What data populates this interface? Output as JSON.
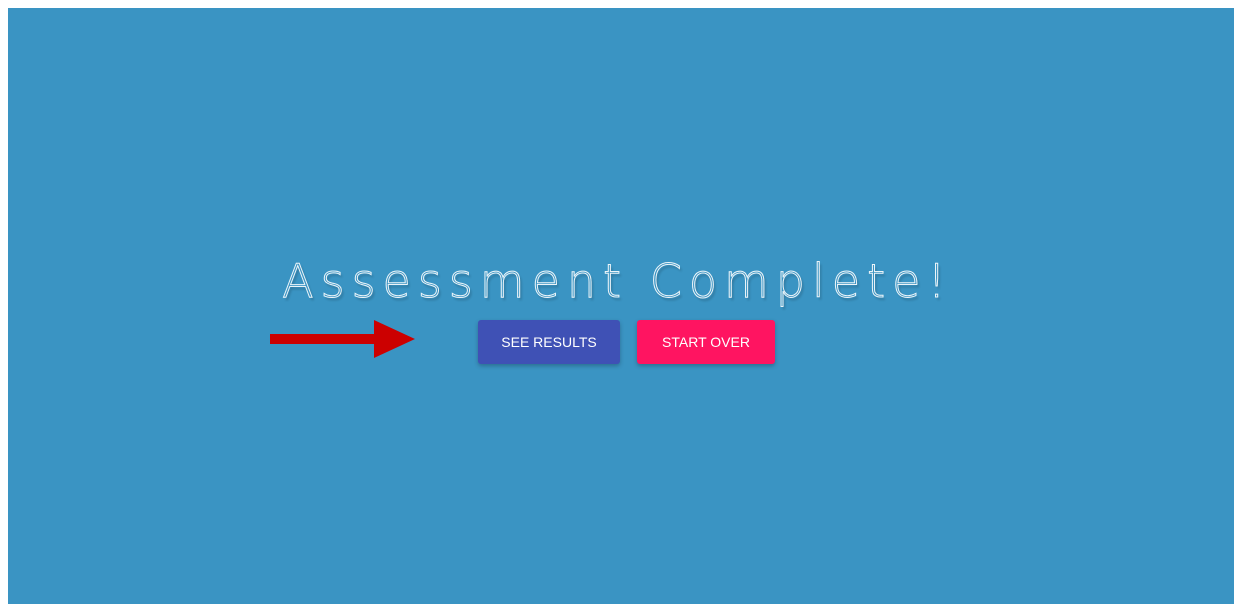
{
  "page": {
    "title": "Assessment Complete!",
    "background_color": "#3a94c3"
  },
  "actions": {
    "see_results_label": "SEE RESULTS",
    "see_results_color": "#3f51b5",
    "start_over_label": "START OVER",
    "start_over_color": "#ff1461"
  },
  "annotation": {
    "arrow_color": "#cc0000",
    "arrow_icon": "arrow-right-icon"
  }
}
